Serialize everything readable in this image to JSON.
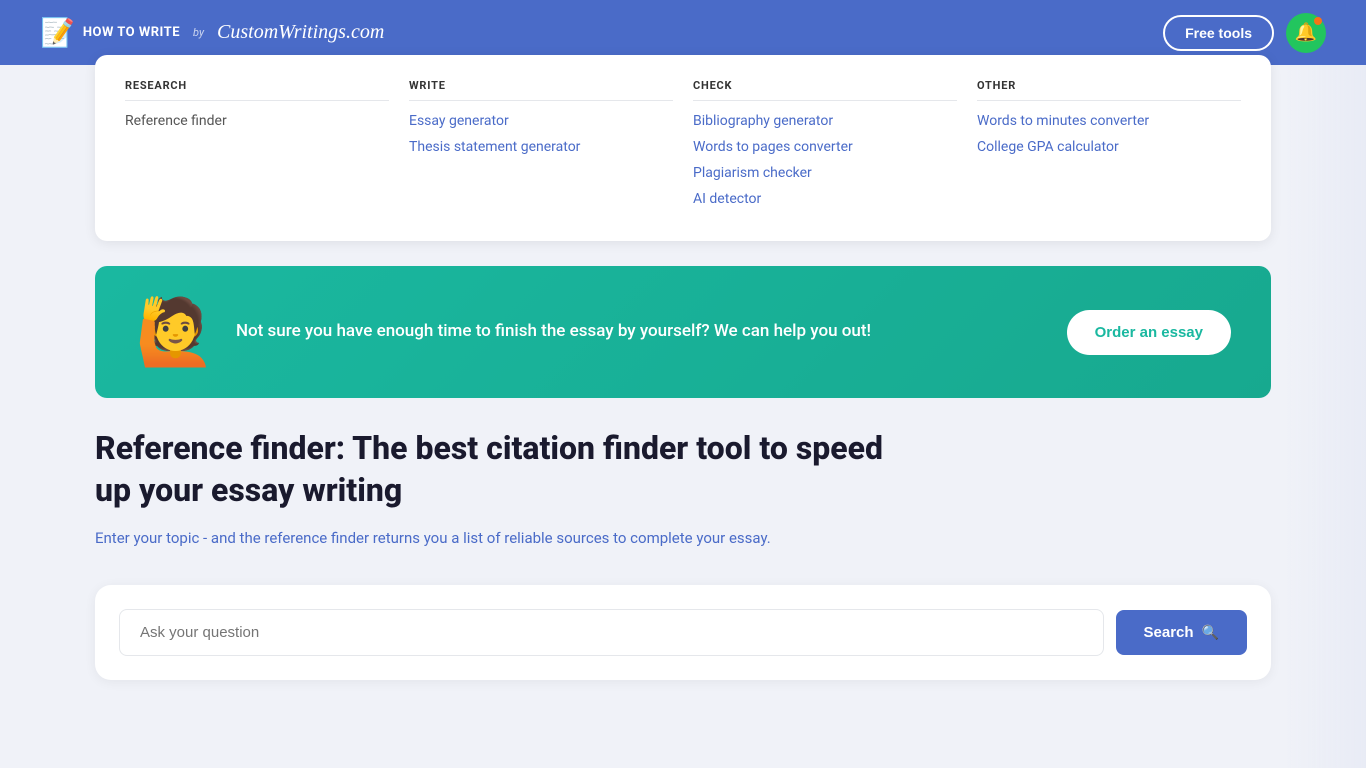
{
  "header": {
    "logo_icon": "📝",
    "logo_how_label": "HOW to WRITE",
    "logo_by": "by",
    "logo_brand": "CustomWritings.com",
    "free_tools_label": "Free tools",
    "bell_aria": "Notifications"
  },
  "dropdown": {
    "research": {
      "title": "RESEARCH",
      "links": [
        {
          "label": "Reference finder",
          "active": false
        }
      ]
    },
    "write": {
      "title": "WRITE",
      "links": [
        {
          "label": "Essay generator"
        },
        {
          "label": "Thesis statement generator"
        }
      ]
    },
    "check": {
      "title": "CHECK",
      "links": [
        {
          "label": "Bibliography generator"
        },
        {
          "label": "Words to pages converter"
        },
        {
          "label": "Plagiarism checker"
        },
        {
          "label": "AI detector"
        }
      ]
    },
    "other": {
      "title": "OTHER",
      "links": [
        {
          "label": "Words to minutes converter"
        },
        {
          "label": "College GPA calculator"
        }
      ]
    }
  },
  "banner": {
    "emoji": "🙋",
    "text": "Not sure you have enough time to finish the essay by yourself? We can help you out!",
    "button_label": "Order an essay"
  },
  "main": {
    "title": "Reference finder: The best citation finder tool to speed up your essay writing",
    "subtitle": "Enter your topic - and the reference finder returns you a list of reliable sources to complete your essay.",
    "search_placeholder": "Ask your question",
    "search_button_label": "Search"
  },
  "colors": {
    "header_bg": "#4a6bc8",
    "link_blue": "#4a6bc8",
    "teal": "#1ab8a0",
    "bell_green": "#22c55e",
    "bell_dot_orange": "#f97316"
  }
}
